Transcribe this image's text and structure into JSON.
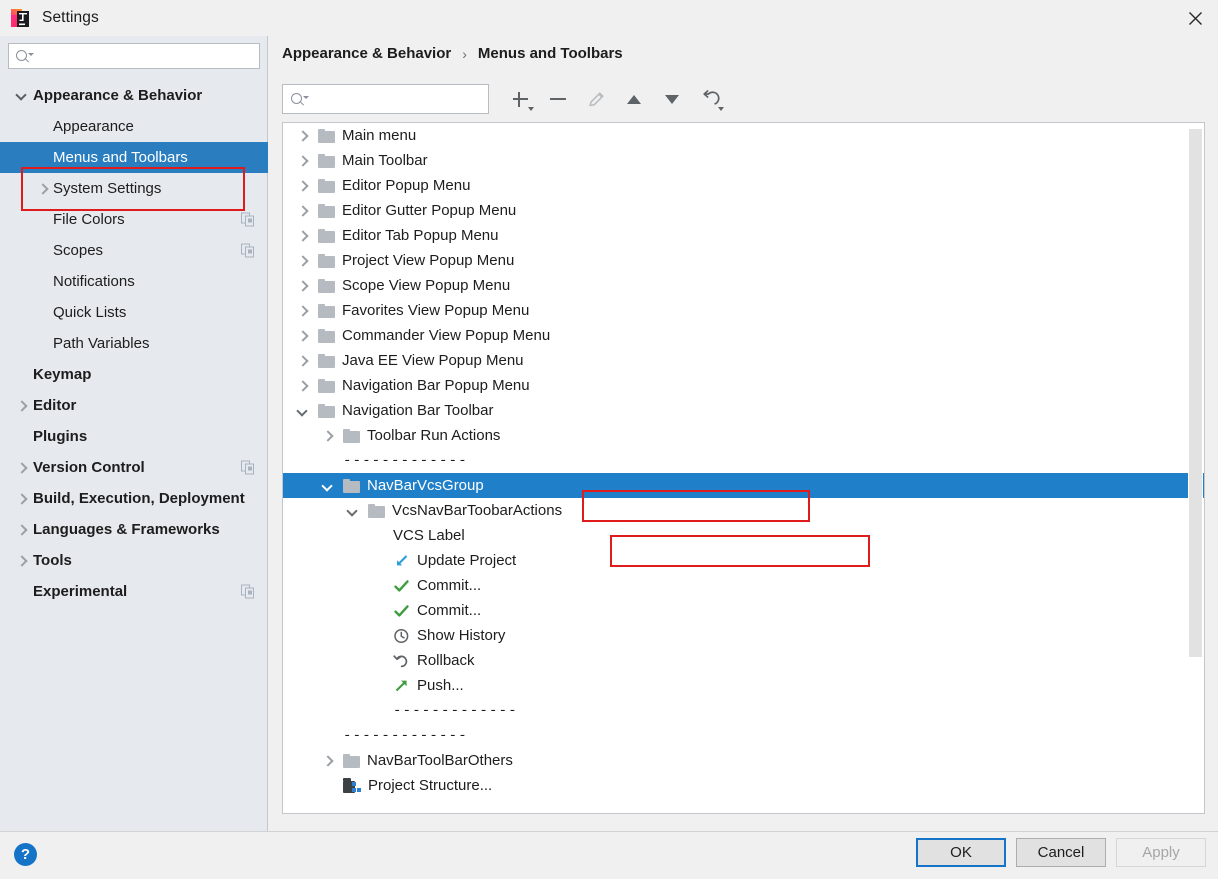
{
  "window": {
    "title": "Settings",
    "app_icon": "intellij-idea-icon",
    "close_icon": "close-icon"
  },
  "sidebar": {
    "search": {
      "placeholder": "",
      "value": "",
      "icon": "search-icon"
    },
    "items": [
      {
        "label": "Appearance & Behavior",
        "level": 0,
        "bold": true,
        "chevron": "down",
        "selected": false,
        "copy_indicator": false
      },
      {
        "label": "Appearance",
        "level": 1,
        "bold": false,
        "chevron": "none",
        "selected": false,
        "copy_indicator": false
      },
      {
        "label": "Menus and Toolbars",
        "level": 1,
        "bold": false,
        "chevron": "none",
        "selected": true,
        "copy_indicator": false
      },
      {
        "label": "System Settings",
        "level": 1,
        "bold": false,
        "chevron": "right",
        "selected": false,
        "copy_indicator": false
      },
      {
        "label": "File Colors",
        "level": 1,
        "bold": false,
        "chevron": "none",
        "selected": false,
        "copy_indicator": true
      },
      {
        "label": "Scopes",
        "level": 1,
        "bold": false,
        "chevron": "none",
        "selected": false,
        "copy_indicator": true
      },
      {
        "label": "Notifications",
        "level": 1,
        "bold": false,
        "chevron": "none",
        "selected": false,
        "copy_indicator": false
      },
      {
        "label": "Quick Lists",
        "level": 1,
        "bold": false,
        "chevron": "none",
        "selected": false,
        "copy_indicator": false
      },
      {
        "label": "Path Variables",
        "level": 1,
        "bold": false,
        "chevron": "none",
        "selected": false,
        "copy_indicator": false
      },
      {
        "label": "Keymap",
        "level": 0,
        "bold": true,
        "chevron": "none",
        "selected": false,
        "copy_indicator": false
      },
      {
        "label": "Editor",
        "level": 0,
        "bold": true,
        "chevron": "right",
        "selected": false,
        "copy_indicator": false
      },
      {
        "label": "Plugins",
        "level": 0,
        "bold": true,
        "chevron": "none",
        "selected": false,
        "copy_indicator": false
      },
      {
        "label": "Version Control",
        "level": 0,
        "bold": true,
        "chevron": "right",
        "selected": false,
        "copy_indicator": true
      },
      {
        "label": "Build, Execution, Deployment",
        "level": 0,
        "bold": true,
        "chevron": "right",
        "selected": false,
        "copy_indicator": false
      },
      {
        "label": "Languages & Frameworks",
        "level": 0,
        "bold": true,
        "chevron": "right",
        "selected": false,
        "copy_indicator": false
      },
      {
        "label": "Tools",
        "level": 0,
        "bold": true,
        "chevron": "right",
        "selected": false,
        "copy_indicator": false
      },
      {
        "label": "Experimental",
        "level": 0,
        "bold": true,
        "chevron": "none",
        "selected": false,
        "copy_indicator": true
      }
    ]
  },
  "main": {
    "breadcrumb": {
      "parent": "Appearance & Behavior",
      "separator": "›",
      "current": "Menus and Toolbars"
    },
    "search": {
      "placeholder": "",
      "value": "",
      "icon": "search-icon"
    },
    "toolbar": [
      {
        "name": "add-button",
        "icon": "plus-icon",
        "label": "Add",
        "enabled": true,
        "has_dropdown": true
      },
      {
        "name": "remove-button",
        "icon": "minus-icon",
        "label": "Remove",
        "enabled": true,
        "has_dropdown": false
      },
      {
        "name": "edit-button",
        "icon": "pencil-icon",
        "label": "Edit",
        "enabled": false,
        "has_dropdown": false
      },
      {
        "name": "move-up-button",
        "icon": "arrow-up-icon",
        "label": "Move Up",
        "enabled": true,
        "has_dropdown": false
      },
      {
        "name": "move-down-button",
        "icon": "arrow-down-icon",
        "label": "Move Down",
        "enabled": true,
        "has_dropdown": false
      },
      {
        "name": "restore-button",
        "icon": "revert-icon",
        "label": "Restore",
        "enabled": true,
        "has_dropdown": true
      }
    ],
    "tree": [
      {
        "label": "Main menu",
        "indent": 0,
        "chevron": "right",
        "icon": "folder-icon",
        "selected": false
      },
      {
        "label": "Main Toolbar",
        "indent": 0,
        "chevron": "right",
        "icon": "folder-icon",
        "selected": false
      },
      {
        "label": "Editor Popup Menu",
        "indent": 0,
        "chevron": "right",
        "icon": "folder-icon",
        "selected": false
      },
      {
        "label": "Editor Gutter Popup Menu",
        "indent": 0,
        "chevron": "right",
        "icon": "folder-icon",
        "selected": false
      },
      {
        "label": "Editor Tab Popup Menu",
        "indent": 0,
        "chevron": "right",
        "icon": "folder-icon",
        "selected": false
      },
      {
        "label": "Project View Popup Menu",
        "indent": 0,
        "chevron": "right",
        "icon": "folder-icon",
        "selected": false
      },
      {
        "label": "Scope View Popup Menu",
        "indent": 0,
        "chevron": "right",
        "icon": "folder-icon",
        "selected": false
      },
      {
        "label": "Favorites View Popup Menu",
        "indent": 0,
        "chevron": "right",
        "icon": "folder-icon",
        "selected": false
      },
      {
        "label": "Commander View Popup Menu",
        "indent": 0,
        "chevron": "right",
        "icon": "folder-icon",
        "selected": false
      },
      {
        "label": "Java EE View Popup Menu",
        "indent": 0,
        "chevron": "right",
        "icon": "folder-icon",
        "selected": false
      },
      {
        "label": "Navigation Bar Popup Menu",
        "indent": 0,
        "chevron": "right",
        "icon": "folder-icon",
        "selected": false
      },
      {
        "label": "Navigation Bar Toolbar",
        "indent": 0,
        "chevron": "down",
        "icon": "folder-icon",
        "selected": false
      },
      {
        "label": "Toolbar Run Actions",
        "indent": 1,
        "chevron": "right",
        "icon": "folder-icon",
        "selected": false
      },
      {
        "label": "-------------",
        "indent": 1,
        "chevron": "none",
        "icon": "separator",
        "selected": false
      },
      {
        "label": "NavBarVcsGroup",
        "indent": 1,
        "chevron": "down",
        "icon": "folder-icon",
        "selected": true
      },
      {
        "label": "VcsNavBarToobarActions",
        "indent": 2,
        "chevron": "down",
        "icon": "folder-icon",
        "selected": false
      },
      {
        "label": "VCS Label",
        "indent": 3,
        "chevron": "none",
        "icon": "none",
        "selected": false
      },
      {
        "label": "Update Project",
        "indent": 3,
        "chevron": "none",
        "icon": "update-project-icon",
        "selected": false
      },
      {
        "label": "Commit...",
        "indent": 3,
        "chevron": "none",
        "icon": "commit-icon",
        "selected": false
      },
      {
        "label": "Commit...",
        "indent": 3,
        "chevron": "none",
        "icon": "commit-icon",
        "selected": false
      },
      {
        "label": "Show History",
        "indent": 3,
        "chevron": "none",
        "icon": "history-icon",
        "selected": false
      },
      {
        "label": "Rollback",
        "indent": 3,
        "chevron": "none",
        "icon": "rollback-icon",
        "selected": false
      },
      {
        "label": "Push...",
        "indent": 3,
        "chevron": "none",
        "icon": "push-icon",
        "selected": false
      },
      {
        "label": "-------------",
        "indent": 3,
        "chevron": "none",
        "icon": "separator",
        "selected": false
      },
      {
        "label": "-------------",
        "indent": 1,
        "chevron": "none",
        "icon": "separator",
        "selected": false
      },
      {
        "label": "NavBarToolBarOthers",
        "indent": 1,
        "chevron": "right",
        "icon": "folder-icon",
        "selected": false
      },
      {
        "label": "Project Structure...",
        "indent": 1,
        "chevron": "none",
        "icon": "project-structure-icon",
        "selected": false
      }
    ],
    "scrollbar": {
      "name": "tree-vertical-scrollbar"
    }
  },
  "annotations": {
    "sidebar_box": "menus-and-toolbars-highlight",
    "separator_box": "separator-row-highlight",
    "vcsnavbar_box": "vcsnavbartoobaractions-highlight",
    "color": "#e01b1b"
  },
  "footer": {
    "help_label": "?",
    "ok_label": "OK",
    "cancel_label": "Cancel",
    "apply_label": "Apply"
  }
}
